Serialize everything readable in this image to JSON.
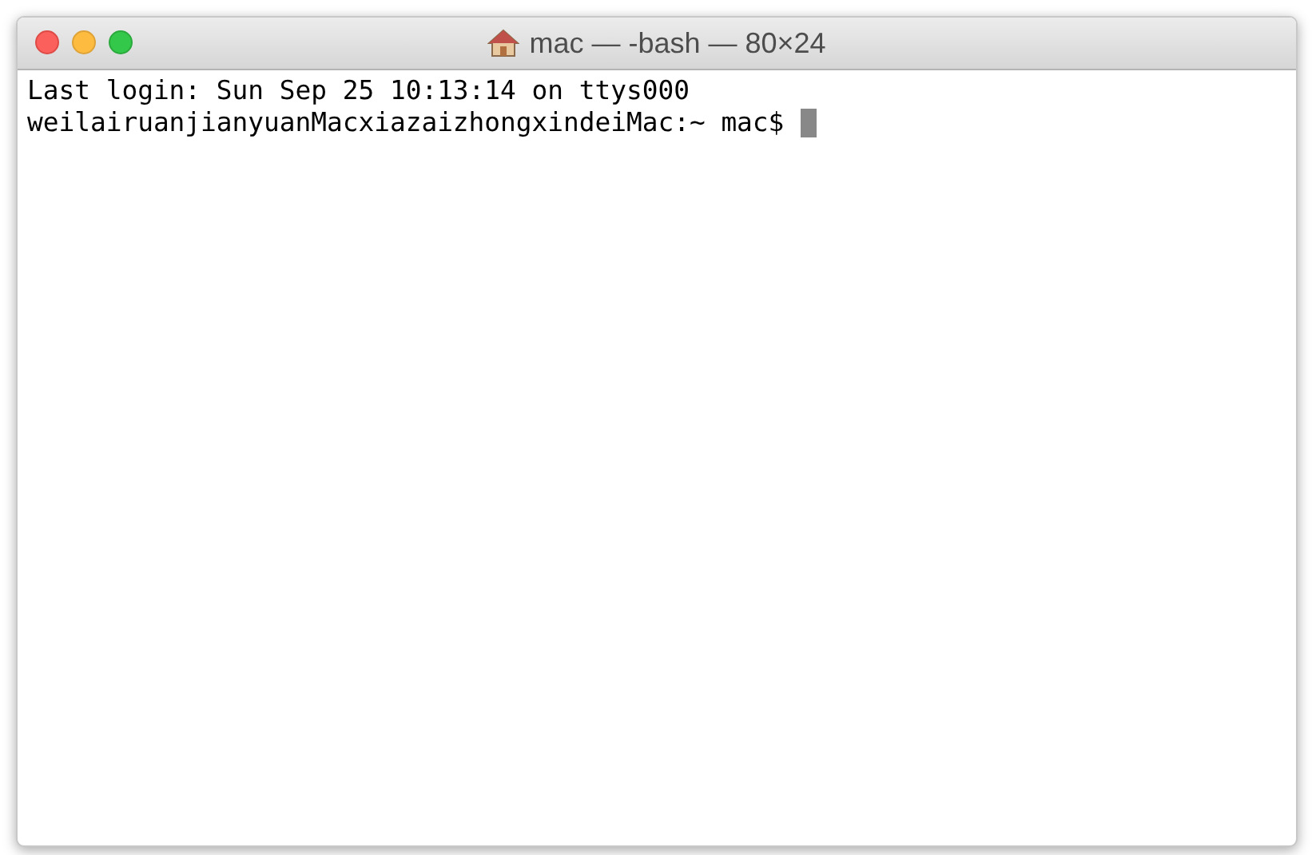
{
  "window": {
    "title": "mac — -bash — 80×24"
  },
  "terminal": {
    "lines": [
      "Last login: Sun Sep 25 10:13:14 on ttys000",
      "weilairuanjianyuanMacxiazaizhongxindeiMac:~ mac$ "
    ],
    "cursor": true
  }
}
